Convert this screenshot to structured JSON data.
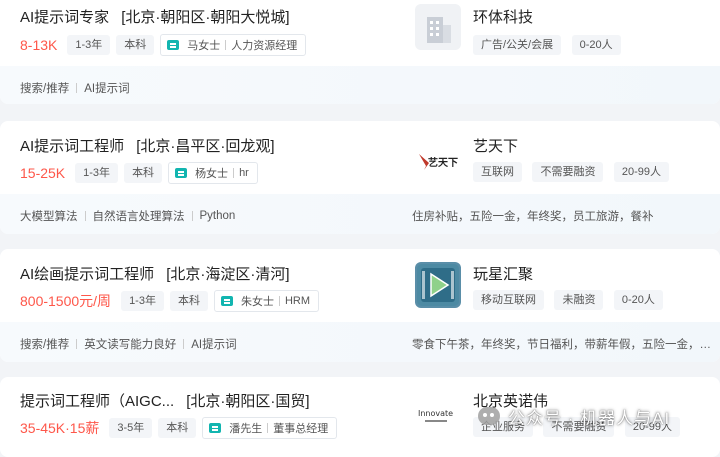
{
  "jobs": [
    {
      "title": "AI提示词专家",
      "area": "[北京·朝阳区·朝阳大悦城]",
      "salary": "8-13K",
      "tags": [
        "1-3年",
        "本科"
      ],
      "recruiter_name": "马女士",
      "recruiter_role": "人力资源经理",
      "company": "环体科技",
      "company_tags": [
        "广告/公关/会展",
        "0-20人"
      ],
      "skills": [
        "搜索/推荐",
        "AI提示词"
      ],
      "welfare": ""
    },
    {
      "title": "AI提示词工程师",
      "area": "[北京·昌平区·回龙观]",
      "salary": "15-25K",
      "tags": [
        "1-3年",
        "本科"
      ],
      "recruiter_name": "杨女士",
      "recruiter_role": "hr",
      "company": "艺天下",
      "company_tags": [
        "互联网",
        "不需要融资",
        "20-99人"
      ],
      "skills": [
        "大模型算法",
        "自然语言处理算法",
        "Python"
      ],
      "welfare": "住房补贴，五险一金，年终奖，员工旅游，餐补",
      "logo_text": "艺天下"
    },
    {
      "title": "AI绘画提示词工程师",
      "area": "[北京·海淀区·清河]",
      "salary": "800-1500元/周",
      "tags": [
        "1-3年",
        "本科"
      ],
      "recruiter_name": "朱女士",
      "recruiter_role": "HRM",
      "company": "玩星汇聚",
      "company_tags": [
        "移动互联网",
        "未融资",
        "0-20人"
      ],
      "skills": [
        "搜索/推荐",
        "英文读写能力良好",
        "AI提示词"
      ],
      "welfare": "零食下午茶，年终奖，节日福利，带薪年假，五险一金，员..."
    },
    {
      "title": "提示词工程师（AIGC...",
      "area": "[北京·朝阳区·国贸]",
      "salary": "35-45K·15薪",
      "tags": [
        "3-5年",
        "本科"
      ],
      "recruiter_name": "潘先生",
      "recruiter_role": "董事总经理",
      "company": "北京英诺伟",
      "company_tags": [
        "企业服务",
        "不需要融资",
        "20-99人"
      ],
      "logo_text": "Innovate"
    }
  ],
  "watermark": "公众号 · 机器人与AI",
  "colors": {
    "salary": "#fe574a",
    "recruiter_icon": "#12b5b0",
    "page_bg": "#f2f4f7"
  }
}
